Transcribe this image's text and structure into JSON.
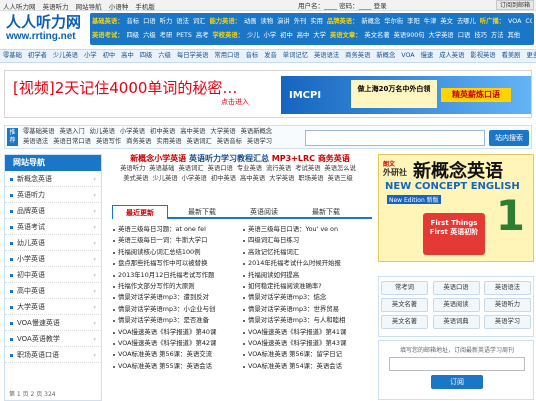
{
  "topbar": {
    "links": [
      "人人听力网",
      "英语听力",
      "网站导航",
      "小语种",
      "手机版"
    ],
    "login": "用户名：____  密码：____  登录",
    "join": "订阅到邮箱"
  },
  "logo": {
    "cn": "人人听力网",
    "url": "www.rrting.net"
  },
  "nav": {
    "row1": [
      {
        "hl": "基础英语："
      },
      {
        "t": "音标"
      },
      {
        "t": "口语"
      },
      {
        "t": "听力"
      },
      {
        "t": "语法"
      },
      {
        "t": "词汇"
      },
      {
        "hl": "能力英语："
      },
      {
        "t": "动画"
      },
      {
        "t": "读物"
      },
      {
        "t": "演讲"
      },
      {
        "t": "外刊"
      },
      {
        "t": "实用"
      },
      {
        "hl": "品牌英语："
      },
      {
        "t": "新概念"
      },
      {
        "t": "华尔街"
      },
      {
        "t": "李阳"
      },
      {
        "t": "牛津"
      },
      {
        "t": "英文"
      },
      {
        "t": "去哪儿"
      },
      {
        "hl": "听广播："
      },
      {
        "t": "VOA"
      },
      {
        "t": "CCTV9"
      },
      {
        "t": "BBC"
      }
    ],
    "row2": [
      {
        "hl": "英语考试："
      },
      {
        "t": "四级"
      },
      {
        "t": "六级"
      },
      {
        "t": "考研"
      },
      {
        "t": "PETS"
      },
      {
        "t": "高考"
      },
      {
        "hl": "学校英语："
      },
      {
        "t": "少儿"
      },
      {
        "t": "小学"
      },
      {
        "t": "初中"
      },
      {
        "t": "高中"
      },
      {
        "t": "大学"
      },
      {
        "hl": "英语文章："
      },
      {
        "t": "英文名著"
      },
      {
        "t": "英语900句"
      },
      {
        "t": "大学英语"
      },
      {
        "t": "口语"
      },
      {
        "t": "技巧"
      },
      {
        "t": "方法"
      },
      {
        "t": "其他"
      }
    ]
  },
  "subnav": [
    "零基础",
    "初学者",
    "少儿英语",
    "小学",
    "初中",
    "高中",
    "四级",
    "六级",
    "每日学英语",
    "常用口语",
    "音标",
    "发音",
    "单词记忆",
    "英语语法",
    "商务英语",
    "新概念",
    "VOA",
    "慢速",
    "成人英语",
    "影视英语",
    "看美剧",
    "更多资讯"
  ],
  "banner": {
    "headline_tag": "[视频]",
    "headline": "2天记住4000单词的秘密…",
    "enter": "点击进入",
    "brand": "IMCPI",
    "box": "做上海20万名中外白领",
    "promo": "精英薪炼口语"
  },
  "search": {
    "label": "推荐",
    "line1": [
      "零基础英语",
      "英语入门",
      "幼儿英语",
      "小学英语",
      "初中英语",
      "高中英语",
      "大学英语",
      "英语新概念"
    ],
    "line2": [
      "英语语法",
      "英语日常口语",
      "英语写作",
      "商务英语",
      "实用英语",
      "英语词汇",
      "英语音标",
      "英语学习"
    ],
    "placeholder": "",
    "button": "站内搜索"
  },
  "sidebar": {
    "title": "网站导航",
    "items": [
      "新概念英语",
      "英语听力",
      "品牌英语",
      "英语考试",
      "幼儿英语",
      "小学英语",
      "初中英语",
      "高中英语",
      "大学英语",
      "VOA慢速英语",
      "VOA英语教学",
      "职场英语口语"
    ],
    "foot": "第 1 页 2 页  324"
  },
  "center": {
    "ad_big": [
      "新概念小学英语",
      "英语听力学习教程汇总",
      "MP3+LRC",
      "商务英语"
    ],
    "ad_rows": [
      [
        "英语听力",
        "英语基础",
        "英语词汇",
        "英语口语",
        "专业英语",
        "流行英语",
        "考试英语",
        "英语怎么说"
      ],
      [
        "美式英语",
        "少儿英语",
        "小学英语",
        "初中英语",
        "高中英语",
        "大学英语",
        "职场英语",
        "英语三级"
      ]
    ],
    "tabs": [
      "最近更新",
      "最新下载",
      "英语阅读",
      "最新下载"
    ],
    "list": [
      [
        "英语三级每日习题：at one fel",
        "英语三级每日口语：You' ve on"
      ],
      [
        "英语三级每日一词：牛斯大学口",
        "四级词汇每日练习"
      ],
      [
        "托福阅读核心词汇总结100例",
        "高效记忆托福词汇"
      ],
      [
        "盘点那些托福写作中可以被替换",
        "2014年托福考试什么时候开始报"
      ],
      [
        "2013年10月12日托福考试写作题",
        "托福阅读如何提高"
      ],
      [
        "托福作文部分写作的大原则",
        "如何稳定托福阅读准确率?"
      ],
      [
        "情景对话学英语mp3：遭到反对",
        "情景对话学英语mp3：惦念"
      ],
      [
        "情景对话学英语mp3：小企业与创",
        "情景对话学英语mp3：世界贸易"
      ],
      [
        "情景对话学英语mp3：是否准备",
        "情景对话学英语mp3：与人和睦相"
      ],
      [
        "VOA慢速英语《科学报道》第40课",
        "VOA慢速英语《科学报道》第41课"
      ],
      [
        "VOA慢速英语《科学报道》第42课",
        "VOA慢速英语《科学报道》第43课"
      ],
      [
        "VOA标准英语 第56课：英语交流",
        "VOA标准英语 第56课：留学日记"
      ],
      [
        "VOA标准英语 第55课：英语会话",
        "VOA标准英语 第54课：英语会话"
      ]
    ]
  },
  "right": {
    "book": {
      "t1": "朗文",
      "t2": "外研社",
      "t3": "新概念英语",
      "t4": "NEW CONCEPT ENGLISH",
      "t5": "New Edition 新版",
      "t6": "First Things First 英语初阶",
      "num": "1"
    },
    "buttons": [
      [
        "常考词",
        "英语口语",
        "英语语法"
      ],
      [
        "英文名著",
        "英语阅读",
        "英语听力"
      ],
      [
        "英文名著",
        "英语词典",
        "英语学习"
      ]
    ],
    "sub_txt": "填写您的邮箱地址，订阅最新英语学习周刊",
    "sub_btn": "订阅"
  }
}
